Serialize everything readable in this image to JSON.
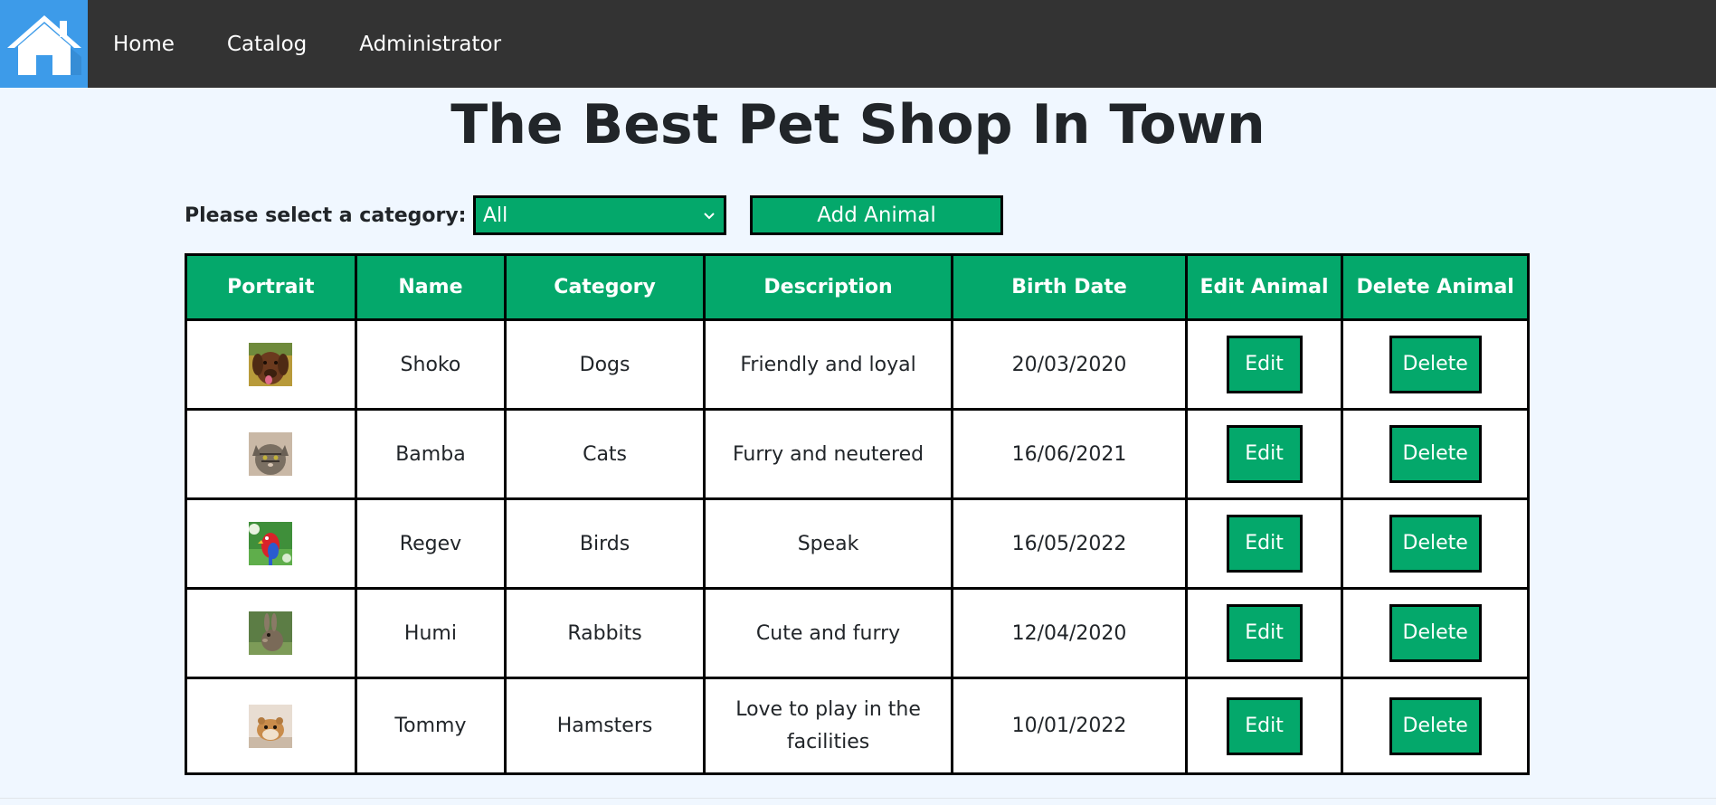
{
  "nav": {
    "logo_icon": "home-icon",
    "links": [
      "Home",
      "Catalog",
      "Administrator"
    ]
  },
  "title": "The Best Pet Shop In Town",
  "controls": {
    "category_label": "Please select a category:",
    "category_selected": "All",
    "add_button": "Add Animal"
  },
  "table": {
    "headers": [
      "Portrait",
      "Name",
      "Category",
      "Description",
      "Birth Date",
      "Edit Animal",
      "Delete Animal"
    ],
    "edit_label": "Edit",
    "delete_label": "Delete",
    "rows": [
      {
        "portrait": "dog-photo",
        "name": "Shoko",
        "category": "Dogs",
        "description": "Friendly and loyal",
        "birth_date": "20/03/2020"
      },
      {
        "portrait": "cat-photo",
        "name": "Bamba",
        "category": "Cats",
        "description": "Furry and neutered",
        "birth_date": "16/06/2021"
      },
      {
        "portrait": "parrot-photo",
        "name": "Regev",
        "category": "Birds",
        "description": "Speak",
        "birth_date": "16/05/2022"
      },
      {
        "portrait": "rabbit-photo",
        "name": "Humi",
        "category": "Rabbits",
        "description": "Cute and furry",
        "birth_date": "12/04/2020"
      },
      {
        "portrait": "hamster-photo",
        "name": "Tommy",
        "category": "Hamsters",
        "description": "Love to play in the facilities",
        "birth_date": "10/01/2022"
      }
    ]
  },
  "colors": {
    "navbar": "#333333",
    "logo_bg": "#3d9be9",
    "accent_green": "#04a86b",
    "page_bg": "#f0f7ff"
  }
}
